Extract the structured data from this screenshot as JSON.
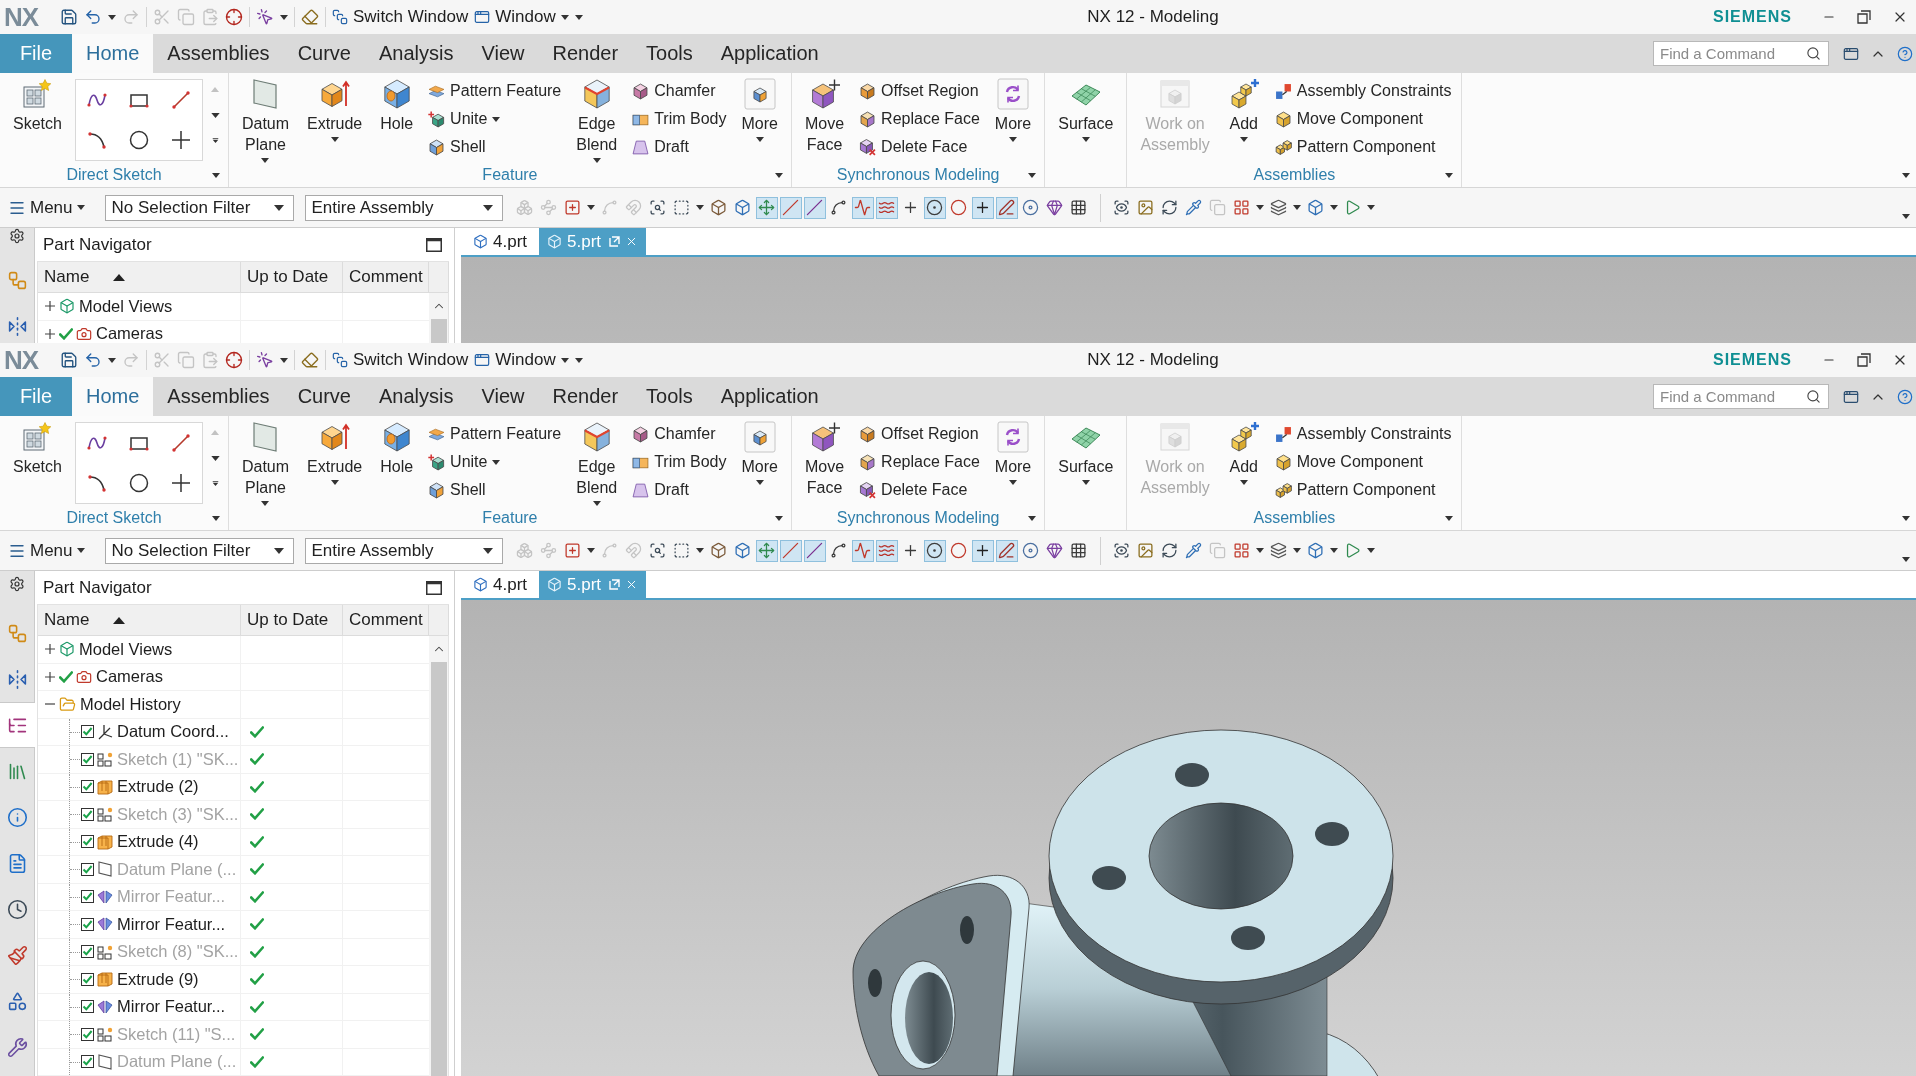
{
  "windows": [
    {
      "quick_access": {
        "logo": "NX",
        "tools": [
          {
            "disabled": false
          },
          {
            "disabled": false,
            "dropdown": true
          },
          {
            "disabled": true
          },
          {
            "disabled": true
          },
          {
            "disabled": true
          },
          {
            "disabled": true
          },
          {
            "disabled": false
          },
          {
            "disabled": false,
            "dropdown": true
          },
          {
            "disabled": false
          }
        ],
        "switch_window": "Switch Window",
        "window_menu": "Window"
      },
      "title": "NX 12 - Modeling",
      "brand": "SIEMENS",
      "file_tab": "File",
      "tabs": [
        {
          "label": "Home",
          "selected": true
        },
        {
          "label": "Assemblies",
          "selected": false
        },
        {
          "label": "Curve",
          "selected": false
        },
        {
          "label": "Analysis",
          "selected": false
        },
        {
          "label": "View",
          "selected": false
        },
        {
          "label": "Render",
          "selected": false
        },
        {
          "label": "Tools",
          "selected": false
        },
        {
          "label": "Application",
          "selected": false
        }
      ],
      "search": {
        "placeholder": "Find a Command"
      },
      "ribbon": [
        {
          "label": "Direct Sketch",
          "items": [
            {
              "kind": "large",
              "label": "Sketch",
              "disabled": false
            },
            {
              "kind": "gallery"
            }
          ]
        },
        {
          "label": "Feature",
          "items": [
            {
              "kind": "large",
              "label": "Datum Plane",
              "disabled": false,
              "dropdown": true
            },
            {
              "kind": "large",
              "label": "Extrude",
              "disabled": false,
              "dropdown": true
            },
            {
              "kind": "large",
              "label": "Hole",
              "disabled": false
            },
            {
              "kind": "stack",
              "items": [
                {
                  "label": "Pattern Feature"
                },
                {
                  "label": "Unite",
                  "dropdown": true
                },
                {
                  "label": "Shell"
                }
              ]
            },
            {
              "kind": "large",
              "label": "Edge Blend",
              "disabled": false,
              "dropdown": true
            },
            {
              "kind": "stack",
              "items": [
                {
                  "label": "Chamfer"
                },
                {
                  "label": "Trim Body"
                },
                {
                  "label": "Draft"
                }
              ]
            },
            {
              "kind": "large",
              "label": "More",
              "disabled": false,
              "dropdown": true
            }
          ]
        },
        {
          "label": "Synchronous Modeling",
          "items": [
            {
              "kind": "large",
              "label": "Move Face",
              "disabled": false
            },
            {
              "kind": "stack",
              "items": [
                {
                  "label": "Offset Region"
                },
                {
                  "label": "Replace Face"
                },
                {
                  "label": "Delete Face"
                }
              ]
            },
            {
              "kind": "large",
              "label": "More",
              "disabled": false,
              "dropdown": true
            }
          ]
        },
        {
          "items": [
            {
              "kind": "large",
              "label": "Surface",
              "disabled": false,
              "dropdown": true
            }
          ]
        },
        {
          "label": "Assemblies",
          "items": [
            {
              "kind": "large",
              "label": "Work on Assembly",
              "disabled": true
            },
            {
              "kind": "large",
              "label": "Add",
              "disabled": false,
              "dropdown": true
            },
            {
              "kind": "stack",
              "items": [
                {
                  "label": "Assembly Constraints"
                },
                {
                  "label": "Move Component"
                },
                {
                  "label": "Pattern Component"
                }
              ]
            }
          ]
        }
      ],
      "toolbar": {
        "menu": "Menu",
        "filters": [
          {
            "value": "No Selection Filter"
          },
          {
            "value": "Entire Assembly"
          }
        ],
        "tool_groups": [
          [
            {
              "selected": false,
              "disabled": true
            },
            {
              "selected": false,
              "disabled": true
            },
            {
              "selected": false,
              "disabled": false,
              "dropdown": true
            },
            {
              "selected": false,
              "disabled": true
            },
            {
              "selected": false,
              "disabled": true
            },
            {
              "selected": false,
              "disabled": false
            },
            {
              "selected": false,
              "disabled": false,
              "dropdown": true
            },
            {
              "selected": false,
              "disabled": false
            },
            {
              "selected": false,
              "disabled": false
            },
            {
              "selected": true,
              "disabled": false
            },
            {
              "selected": true,
              "disabled": false
            },
            {
              "selected": true,
              "disabled": false
            },
            {
              "selected": false,
              "disabled": false
            },
            {
              "selected": true,
              "disabled": false
            },
            {
              "selected": true,
              "disabled": false
            },
            {
              "selected": false,
              "disabled": false
            },
            {
              "selected": true,
              "disabled": false
            },
            {
              "selected": false,
              "disabled": false
            },
            {
              "selected": true,
              "disabled": false
            },
            {
              "selected": true,
              "disabled": false
            },
            {
              "selected": false,
              "disabled": false
            },
            {
              "selected": false,
              "disabled": false
            },
            {
              "selected": false,
              "disabled": false
            }
          ],
          [
            {
              "selected": false,
              "disabled": false
            },
            {
              "selected": false,
              "disabled": false
            },
            {
              "selected": false,
              "disabled": false
            },
            {
              "selected": false,
              "disabled": false
            },
            {
              "selected": false,
              "disabled": true
            },
            {
              "selected": false,
              "disabled": false,
              "dropdown": true
            },
            {
              "selected": false,
              "disabled": false,
              "dropdown": true
            },
            {
              "selected": false,
              "disabled": false,
              "dropdown": true
            },
            {
              "selected": false,
              "disabled": false,
              "dropdown": true
            }
          ]
        ]
      },
      "resource_bar": [
        {
          "selected": false
        },
        {
          "selected": false
        }
      ],
      "navigator": {
        "title": "Part Navigator",
        "columns": [
          {
            "label": "Name",
            "sorted": true
          },
          {
            "label": "Up to Date",
            "sorted": false
          },
          {
            "label": "Comment",
            "sorted": false
          }
        ],
        "tree": [
          {
            "label": "Model Views",
            "kind": "views",
            "expanded": false
          },
          {
            "label": "Cameras",
            "kind": "cameras",
            "expanded": false,
            "checked": true
          }
        ]
      },
      "documents": [
        {
          "label": "4.prt",
          "selected": false
        },
        {
          "label": "5.prt",
          "selected": true
        }
      ]
    },
    {
      "quick_access": {
        "logo": "NX",
        "tools": [
          {
            "disabled": false
          },
          {
            "disabled": false,
            "dropdown": true
          },
          {
            "disabled": true
          },
          {
            "disabled": true
          },
          {
            "disabled": true
          },
          {
            "disabled": true
          },
          {
            "disabled": false
          },
          {
            "disabled": false,
            "dropdown": true
          },
          {
            "disabled": false
          }
        ],
        "switch_window": "Switch Window",
        "window_menu": "Window"
      },
      "title": "NX 12 - Modeling",
      "brand": "SIEMENS",
      "file_tab": "File",
      "tabs": [
        {
          "label": "Home",
          "selected": true
        },
        {
          "label": "Assemblies",
          "selected": false
        },
        {
          "label": "Curve",
          "selected": false
        },
        {
          "label": "Analysis",
          "selected": false
        },
        {
          "label": "View",
          "selected": false
        },
        {
          "label": "Render",
          "selected": false
        },
        {
          "label": "Tools",
          "selected": false
        },
        {
          "label": "Application",
          "selected": false
        }
      ],
      "search": {
        "placeholder": "Find a Command"
      },
      "ribbon": [
        {
          "label": "Direct Sketch",
          "items": [
            {
              "kind": "large",
              "label": "Sketch",
              "disabled": false
            },
            {
              "kind": "gallery"
            }
          ]
        },
        {
          "label": "Feature",
          "items": [
            {
              "kind": "large",
              "label": "Datum Plane",
              "disabled": false,
              "dropdown": true
            },
            {
              "kind": "large",
              "label": "Extrude",
              "disabled": false,
              "dropdown": true
            },
            {
              "kind": "large",
              "label": "Hole",
              "disabled": false
            },
            {
              "kind": "stack",
              "items": [
                {
                  "label": "Pattern Feature"
                },
                {
                  "label": "Unite",
                  "dropdown": true
                },
                {
                  "label": "Shell"
                }
              ]
            },
            {
              "kind": "large",
              "label": "Edge Blend",
              "disabled": false,
              "dropdown": true
            },
            {
              "kind": "stack",
              "items": [
                {
                  "label": "Chamfer"
                },
                {
                  "label": "Trim Body"
                },
                {
                  "label": "Draft"
                }
              ]
            },
            {
              "kind": "large",
              "label": "More",
              "disabled": false,
              "dropdown": true
            }
          ]
        },
        {
          "label": "Synchronous Modeling",
          "items": [
            {
              "kind": "large",
              "label": "Move Face",
              "disabled": false
            },
            {
              "kind": "stack",
              "items": [
                {
                  "label": "Offset Region"
                },
                {
                  "label": "Replace Face"
                },
                {
                  "label": "Delete Face"
                }
              ]
            },
            {
              "kind": "large",
              "label": "More",
              "disabled": false,
              "dropdown": true
            }
          ]
        },
        {
          "items": [
            {
              "kind": "large",
              "label": "Surface",
              "disabled": false,
              "dropdown": true
            }
          ]
        },
        {
          "label": "Assemblies",
          "items": [
            {
              "kind": "large",
              "label": "Work on Assembly",
              "disabled": true
            },
            {
              "kind": "large",
              "label": "Add",
              "disabled": false,
              "dropdown": true
            },
            {
              "kind": "stack",
              "items": [
                {
                  "label": "Assembly Constraints"
                },
                {
                  "label": "Move Component"
                },
                {
                  "label": "Pattern Component"
                }
              ]
            }
          ]
        }
      ],
      "toolbar": {
        "menu": "Menu",
        "filters": [
          {
            "value": "No Selection Filter"
          },
          {
            "value": "Entire Assembly"
          }
        ],
        "tool_groups": [
          [
            {
              "selected": false,
              "disabled": true
            },
            {
              "selected": false,
              "disabled": true
            },
            {
              "selected": false,
              "disabled": false,
              "dropdown": true
            },
            {
              "selected": false,
              "disabled": true
            },
            {
              "selected": false,
              "disabled": true
            },
            {
              "selected": false,
              "disabled": false
            },
            {
              "selected": false,
              "disabled": false,
              "dropdown": true
            },
            {
              "selected": false,
              "disabled": false
            },
            {
              "selected": false,
              "disabled": false
            },
            {
              "selected": true,
              "disabled": false
            },
            {
              "selected": true,
              "disabled": false
            },
            {
              "selected": true,
              "disabled": false
            },
            {
              "selected": false,
              "disabled": false
            },
            {
              "selected": true,
              "disabled": false
            },
            {
              "selected": true,
              "disabled": false
            },
            {
              "selected": false,
              "disabled": false
            },
            {
              "selected": true,
              "disabled": false
            },
            {
              "selected": false,
              "disabled": false
            },
            {
              "selected": true,
              "disabled": false
            },
            {
              "selected": true,
              "disabled": false
            },
            {
              "selected": false,
              "disabled": false
            },
            {
              "selected": false,
              "disabled": false
            },
            {
              "selected": false,
              "disabled": false
            }
          ],
          [
            {
              "selected": false,
              "disabled": false
            },
            {
              "selected": false,
              "disabled": false
            },
            {
              "selected": false,
              "disabled": false
            },
            {
              "selected": false,
              "disabled": false
            },
            {
              "selected": false,
              "disabled": true
            },
            {
              "selected": false,
              "disabled": false,
              "dropdown": true
            },
            {
              "selected": false,
              "disabled": false,
              "dropdown": true
            },
            {
              "selected": false,
              "disabled": false,
              "dropdown": true
            },
            {
              "selected": false,
              "disabled": false,
              "dropdown": true
            }
          ]
        ]
      },
      "resource_bar": [
        {
          "selected": false
        },
        {
          "selected": false
        },
        {
          "selected": true
        },
        {
          "selected": false
        },
        {
          "selected": false
        },
        {
          "selected": false
        },
        {
          "selected": false
        },
        {
          "selected": false
        },
        {
          "selected": false
        },
        {
          "selected": false
        }
      ],
      "navigator": {
        "title": "Part Navigator",
        "columns": [
          {
            "label": "Name",
            "sorted": true
          },
          {
            "label": "Up to Date",
            "sorted": false
          },
          {
            "label": "Comment",
            "sorted": false
          }
        ],
        "tree": [
          {
            "label": "Model Views",
            "kind": "views",
            "expanded": false
          },
          {
            "label": "Cameras",
            "kind": "cameras",
            "expanded": false,
            "checked": true
          },
          {
            "label": "Model History",
            "kind": "folder",
            "expanded": true,
            "children": [
              {
                "label": "Datum Coord...",
                "kind": "datum_csys",
                "checked": true,
                "dimmed": false,
                "up_to_date": true
              },
              {
                "label": "Sketch (1) \"SK...",
                "kind": "sketch",
                "checked": true,
                "dimmed": true,
                "up_to_date": true
              },
              {
                "label": "Extrude (2)",
                "kind": "extrude",
                "checked": true,
                "dimmed": false,
                "up_to_date": true
              },
              {
                "label": "Sketch (3) \"SK...",
                "kind": "sketch",
                "checked": true,
                "dimmed": true,
                "up_to_date": true
              },
              {
                "label": "Extrude (4)",
                "kind": "extrude",
                "checked": true,
                "dimmed": false,
                "up_to_date": true
              },
              {
                "label": "Datum Plane (...",
                "kind": "datum_plane",
                "checked": true,
                "dimmed": true,
                "up_to_date": true
              },
              {
                "label": "Mirror Featur...",
                "kind": "mirror",
                "checked": true,
                "dimmed": true,
                "up_to_date": true
              },
              {
                "label": "Mirror Featur...",
                "kind": "mirror",
                "checked": true,
                "dimmed": false,
                "up_to_date": true
              },
              {
                "label": "Sketch (8) \"SK...",
                "kind": "sketch",
                "checked": true,
                "dimmed": true,
                "up_to_date": true
              },
              {
                "label": "Extrude (9)",
                "kind": "extrude",
                "checked": true,
                "dimmed": false,
                "up_to_date": true
              },
              {
                "label": "Mirror Featur...",
                "kind": "mirror",
                "checked": true,
                "dimmed": false,
                "up_to_date": true
              },
              {
                "label": "Sketch (11) \"S...",
                "kind": "sketch",
                "checked": true,
                "dimmed": true,
                "up_to_date": true
              },
              {
                "label": "Datum Plane (...",
                "kind": "datum_plane",
                "checked": true,
                "dimmed": true,
                "up_to_date": true
              }
            ]
          }
        ]
      },
      "documents": [
        {
          "label": "4.prt",
          "selected": false
        },
        {
          "label": "5.prt",
          "selected": true
        }
      ],
      "viewport": {
        "model_visible": true
      }
    }
  ]
}
